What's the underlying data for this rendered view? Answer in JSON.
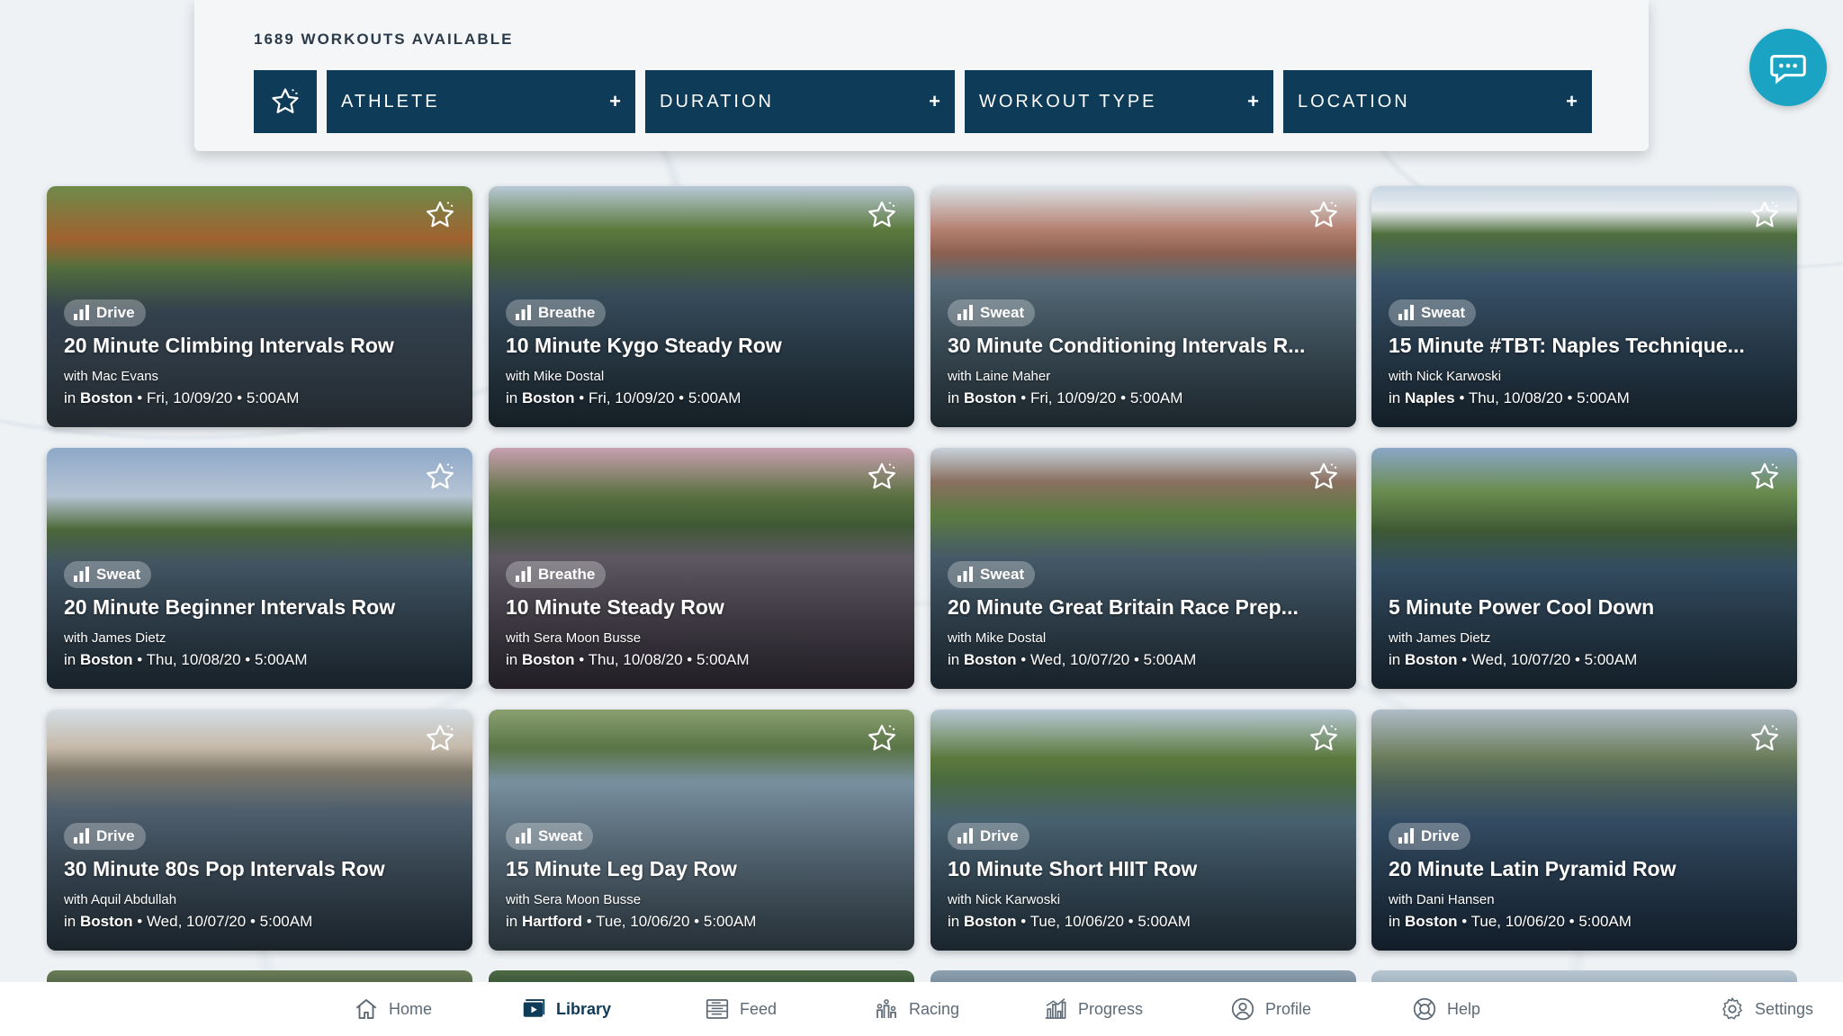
{
  "header": {
    "workout_count": "1689 WORKOUTS AVAILABLE",
    "filters": [
      {
        "label": "ATHLETE",
        "icon": "plus-icon"
      },
      {
        "label": "DURATION",
        "icon": "plus-icon"
      },
      {
        "label": "WORKOUT TYPE",
        "icon": "plus-icon"
      },
      {
        "label": "LOCATION",
        "icon": "plus-icon"
      }
    ]
  },
  "workouts": [
    {
      "type": "Drive",
      "title": "20 Minute Climbing Intervals Row",
      "coach": "with Mac Evans",
      "city": "Boston",
      "date": "Fri, 10/09/20",
      "time": "5:00AM"
    },
    {
      "type": "Breathe",
      "title": "10 Minute Kygo Steady Row",
      "coach": "with Mike Dostal",
      "city": "Boston",
      "date": "Fri, 10/09/20",
      "time": "5:00AM"
    },
    {
      "type": "Sweat",
      "title": "30 Minute Conditioning Intervals R...",
      "coach": "with Laine Maher",
      "city": "Boston",
      "date": "Fri, 10/09/20",
      "time": "5:00AM"
    },
    {
      "type": "Sweat",
      "title": "15 Minute #TBT: Naples Technique...",
      "coach": "with Nick Karwoski",
      "city": "Naples",
      "date": "Thu, 10/08/20",
      "time": "5:00AM"
    },
    {
      "type": "Sweat",
      "title": "20 Minute Beginner Intervals Row",
      "coach": "with James Dietz",
      "city": "Boston",
      "date": "Thu, 10/08/20",
      "time": "5:00AM"
    },
    {
      "type": "Breathe",
      "title": "10 Minute Steady Row",
      "coach": "with Sera Moon Busse",
      "city": "Boston",
      "date": "Thu, 10/08/20",
      "time": "5:00AM"
    },
    {
      "type": "Sweat",
      "title": "20 Minute Great Britain Race Prep...",
      "coach": "with Mike Dostal",
      "city": "Boston",
      "date": "Wed, 10/07/20",
      "time": "5:00AM"
    },
    {
      "type": "",
      "title": "5 Minute Power Cool Down",
      "coach": "with James Dietz",
      "city": "Boston",
      "date": "Wed, 10/07/20",
      "time": "5:00AM"
    },
    {
      "type": "Drive",
      "title": "30 Minute 80s Pop Intervals Row",
      "coach": "with Aquil Abdullah",
      "city": "Boston",
      "date": "Wed, 10/07/20",
      "time": "5:00AM"
    },
    {
      "type": "Sweat",
      "title": "15 Minute Leg Day Row",
      "coach": "with Sera Moon Busse",
      "city": "Hartford",
      "date": "Tue, 10/06/20",
      "time": "5:00AM"
    },
    {
      "type": "Drive",
      "title": "10 Minute Short HIIT Row",
      "coach": "with Nick Karwoski",
      "city": "Boston",
      "date": "Tue, 10/06/20",
      "time": "5:00AM"
    },
    {
      "type": "Drive",
      "title": "20 Minute Latin Pyramid Row",
      "coach": "with Dani Hansen",
      "city": "Boston",
      "date": "Tue, 10/06/20",
      "time": "5:00AM"
    }
  ],
  "meta_prefix": "in",
  "meta_sep": "•",
  "nav": [
    {
      "label": "Home",
      "icon": "home-icon"
    },
    {
      "label": "Library",
      "icon": "library-icon",
      "active": true
    },
    {
      "label": "Feed",
      "icon": "feed-icon"
    },
    {
      "label": "Racing",
      "icon": "racing-icon"
    },
    {
      "label": "Progress",
      "icon": "progress-icon"
    },
    {
      "label": "Profile",
      "icon": "profile-icon"
    },
    {
      "label": "Help",
      "icon": "help-icon"
    },
    {
      "label": "Settings",
      "icon": "settings-icon"
    }
  ],
  "colors": {
    "filter_bg": "#0e3b57",
    "chat_button": "#1aa3c2",
    "active_nav": "#0e3b57",
    "inactive_nav": "#5d6a75"
  }
}
